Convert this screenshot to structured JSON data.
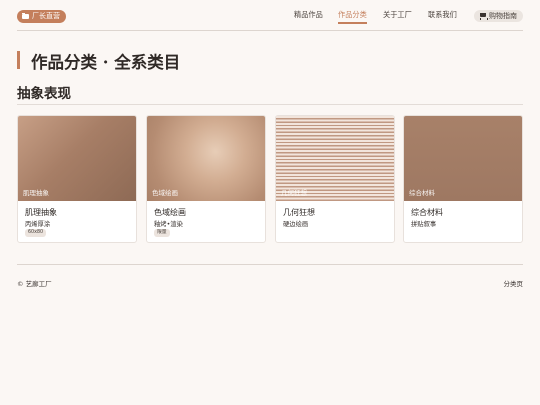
{
  "header": {
    "brand": "厂长直营",
    "nav": [
      "精品作品",
      "作品分类",
      "关于工厂",
      "联系我们"
    ],
    "active_nav": "作品分类",
    "guide_button": "购物指南"
  },
  "page_title": "作品分类 · 全系类目",
  "section": {
    "title": "抽象表现"
  },
  "cards": [
    {
      "thumb_label": "肌理抽象",
      "title": "肌理抽象",
      "subtitle": "丙烯厚涂",
      "chip": "60x80"
    },
    {
      "thumb_label": "色域绘画",
      "title": "色域绘画",
      "subtitle": "釉烤•渲染",
      "chip": "限量"
    },
    {
      "thumb_label": "几何狂想",
      "title": "几何狂想",
      "subtitle": "硬边绘画",
      "chip": ""
    },
    {
      "thumb_label": "综合材料",
      "title": "综合材料",
      "subtitle": "拼贴叙事",
      "chip": ""
    }
  ],
  "footer": {
    "copyright": "© 艺廊工厂",
    "right_link": "分类页"
  },
  "colors": {
    "accent": "#c47f5c",
    "background": "#fbf7f4"
  },
  "icons": {
    "brand": "folder-icon",
    "guide": "cart-icon"
  }
}
